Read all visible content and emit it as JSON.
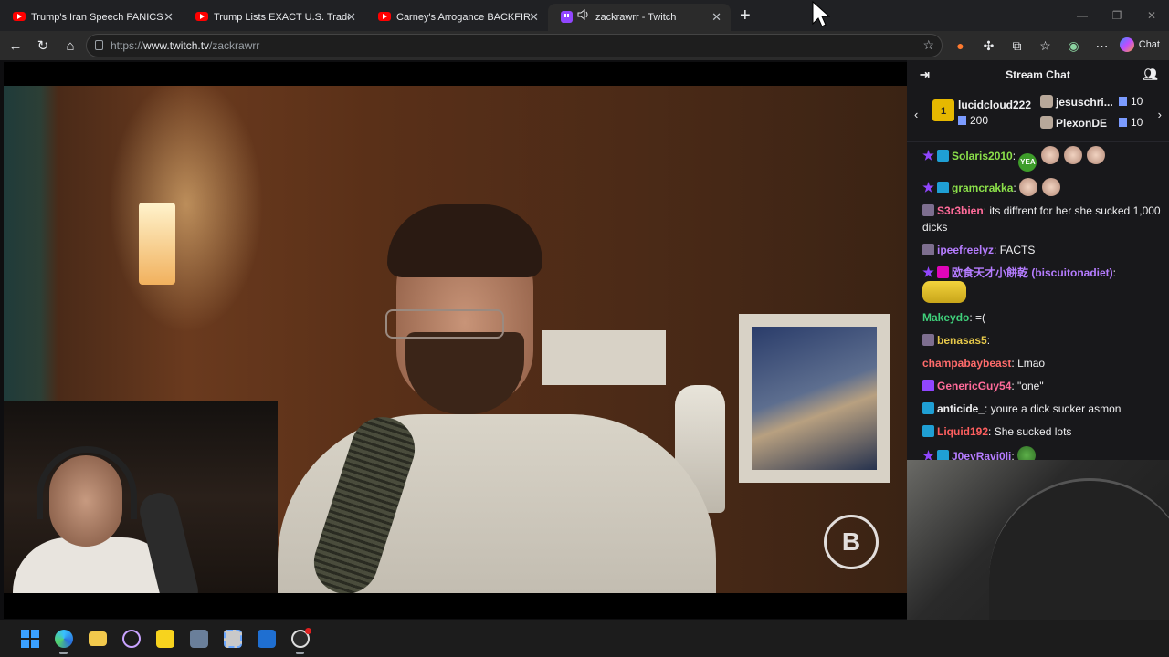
{
  "browser": {
    "tabs": [
      {
        "title": "Trump's Iran Speech PANICS The M",
        "icon": "youtube-icon"
      },
      {
        "title": "Trump Lists EXACT U.S. Trade Deal",
        "icon": "youtube-icon"
      },
      {
        "title": "Carney's Arrogance BACKFIRES as",
        "icon": "youtube-icon"
      },
      {
        "title": "zackrawrr - Twitch",
        "icon": "twitch-icon",
        "active": true,
        "audio": true
      }
    ],
    "new_tab": "+",
    "url_prefix": "https://",
    "url_host": "www.twitch.tv",
    "url_path": "/zackrawrr",
    "chat_button": "Chat"
  },
  "chat": {
    "title": "Stream Chat",
    "leaderboard": {
      "top": {
        "rank": "1",
        "name": "lucidcloud222",
        "amount": "200"
      },
      "others": [
        {
          "name": "jesuschri...",
          "amount": "10"
        },
        {
          "name": "PlexonDE",
          "amount": "10"
        }
      ]
    },
    "messages": [
      {
        "user": "Solaris2010",
        "color": "#8be04a",
        "text": "",
        "badges": [
          "prime",
          "crown"
        ],
        "emotes": [
          "yea",
          "face",
          "face",
          "face"
        ]
      },
      {
        "user": "gramcrakka",
        "color": "#8be04a",
        "text": "",
        "badges": [
          "prime",
          "crown"
        ],
        "emotes": [
          "face",
          "face"
        ]
      },
      {
        "user": "S3r3bien",
        "color": "#ff6b9a",
        "text": "its diffrent for her she sucked 1,000 dicks",
        "badges": [
          "avatar"
        ]
      },
      {
        "user": "ipeefreelyz",
        "color": "#b57cff",
        "text": "FACTS",
        "badges": [
          "avatar"
        ]
      },
      {
        "user": "欧食天才小餅乾 (biscuitonadiet)",
        "color": "#b57cff",
        "text": "",
        "badges": [
          "prime",
          "vip"
        ],
        "emotes": [
          "minion"
        ]
      },
      {
        "user": "Makeydo",
        "color": "#3fcf7a",
        "text": "=(",
        "badges": []
      },
      {
        "user": "benasas5",
        "color": "#e6c84a",
        "text": "",
        "badges": [
          "avatar"
        ]
      },
      {
        "user": "champabaybeast",
        "color": "#ff6b6b",
        "text": "Lmao",
        "badges": []
      },
      {
        "user": "GenericGuy54",
        "color": "#ff6b9a",
        "text": "\"one\"",
        "badges": [
          "twitch"
        ]
      },
      {
        "user": "anticide_",
        "color": "#efeff1",
        "text": "youre a dick sucker asmon",
        "badges": [
          "crown"
        ]
      },
      {
        "user": "Liquid192",
        "color": "#ff5f5f",
        "text": "She sucked lots",
        "badges": [
          "crown"
        ]
      },
      {
        "user": "J0eyRavi0li",
        "color": "#b57cff",
        "text": "",
        "badges": [
          "prime",
          "crown"
        ],
        "emotes": [
          "pepe"
        ]
      }
    ]
  },
  "video": {
    "watermark": "B"
  },
  "taskbar": {
    "icons": [
      "windows-start-icon",
      "edge-icon",
      "file-explorer-icon",
      "media-player-icon",
      "sticky-notes-icon",
      "calculator-icon",
      "snipping-tool-icon",
      "store-icon",
      "obs-icon"
    ]
  },
  "colors": {
    "twitch_purple": "#9146ff",
    "chat_bg": "#18181b",
    "tab_bar": "#202124"
  }
}
